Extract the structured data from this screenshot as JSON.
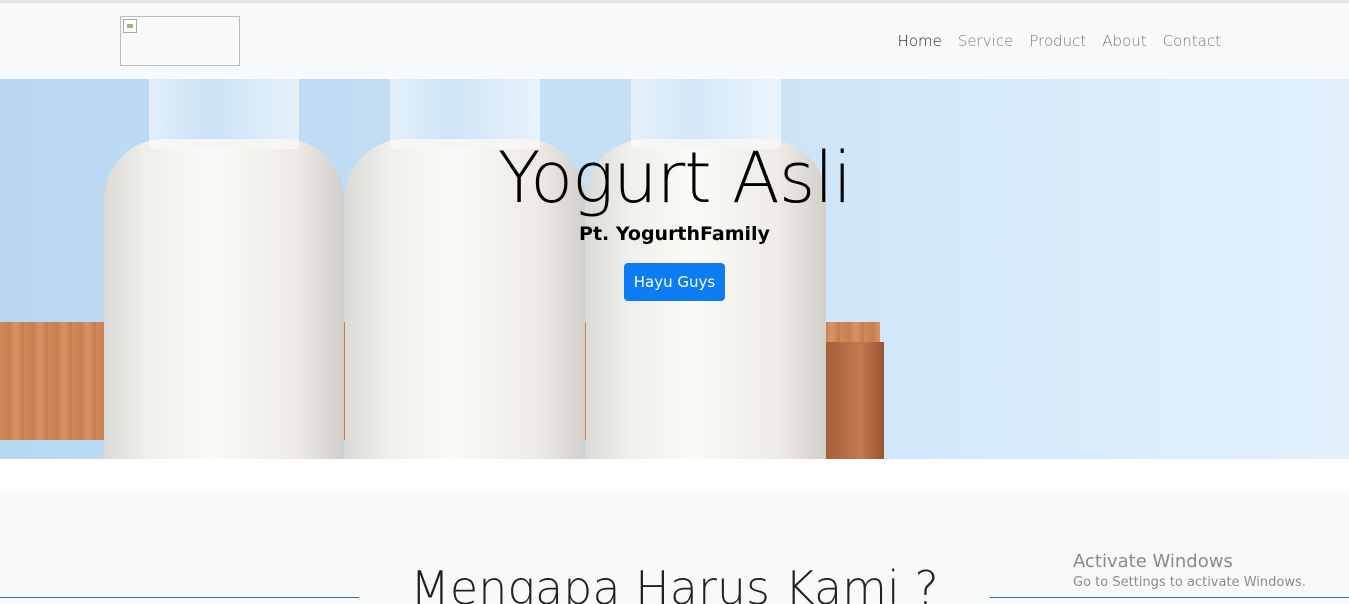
{
  "nav": {
    "links": [
      "Home",
      "Service",
      "Product",
      "About",
      "Contact"
    ]
  },
  "hero": {
    "title": "Yogurt Asli",
    "subtitle": "Pt. YogurthFamily",
    "button": "Hayu Guys"
  },
  "section": {
    "title": "Mengapa Harus Kami ?"
  },
  "watermark": {
    "line1": "Activate Windows",
    "line2": "Go to Settings to activate Windows."
  },
  "colors": {
    "primary_button": "#0d7cf2",
    "navbar_bg": "#f8f9fa",
    "divider": "#2e7d74"
  }
}
